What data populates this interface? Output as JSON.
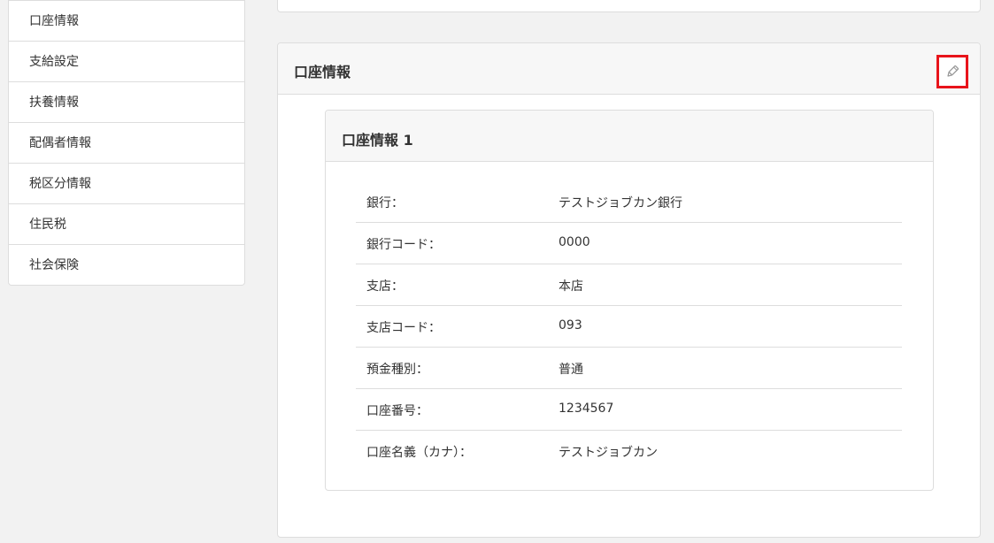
{
  "sidebar": {
    "items": [
      {
        "label": "口座情報"
      },
      {
        "label": "支給設定"
      },
      {
        "label": "扶養情報"
      },
      {
        "label": "配偶者情報"
      },
      {
        "label": "税区分情報"
      },
      {
        "label": "住民税"
      },
      {
        "label": "社会保険"
      }
    ]
  },
  "panel": {
    "title": "口座情報",
    "edit_icon": "pencil-icon",
    "edit_highlight_color": "#e8141b"
  },
  "account": {
    "title": "口座情報 1",
    "rows": [
      {
        "label": "銀行：",
        "value": "テストジョブカン銀行"
      },
      {
        "label": "銀行コード：",
        "value": "0000"
      },
      {
        "label": "支店：",
        "value": "本店"
      },
      {
        "label": "支店コード：",
        "value": "093"
      },
      {
        "label": "預金種別：",
        "value": "普通"
      },
      {
        "label": "口座番号：",
        "value": "1234567"
      },
      {
        "label": "口座名義（カナ）：",
        "value": "テストジョブカン"
      }
    ]
  }
}
